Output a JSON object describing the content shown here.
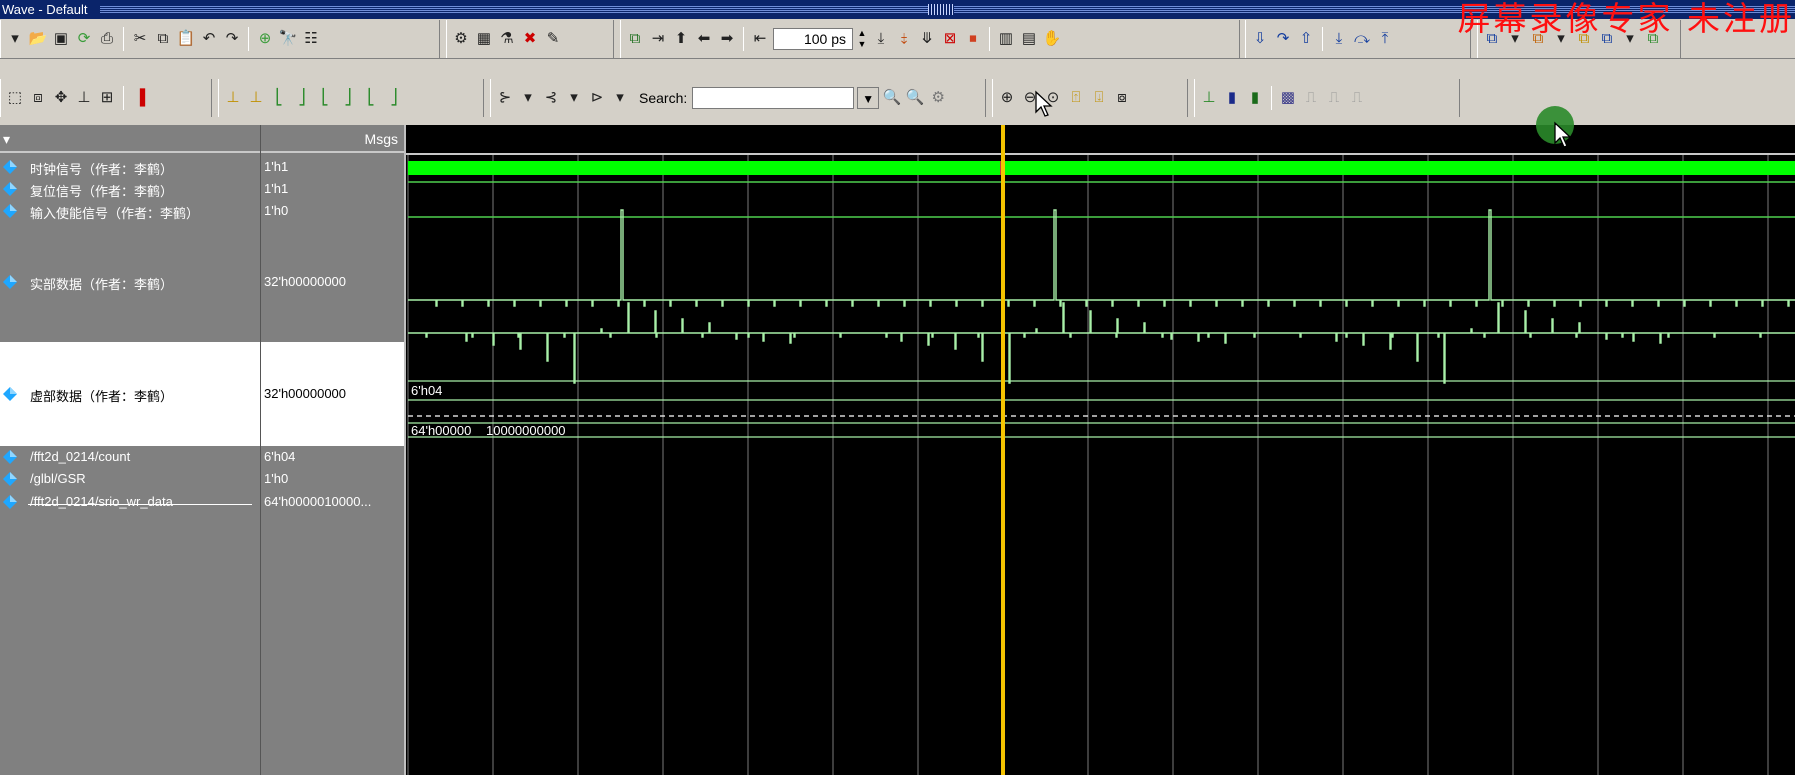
{
  "window": {
    "title": "Wave - Default",
    "watermark": "屏幕录像专家  未注册"
  },
  "toolbar": {
    "time_value": "100 ps",
    "search_label": "Search:",
    "search_value": ""
  },
  "panes": {
    "name_header": "",
    "value_header": "Msgs"
  },
  "signals": [
    {
      "name": "时钟信号（作者：李鹤）",
      "value": "1'h1"
    },
    {
      "name": "复位信号（作者：李鹤）",
      "value": "1'h1"
    },
    {
      "name": "输入使能信号（作者：李鹤）",
      "value": "1'h0"
    },
    {
      "name": "实部数据（作者：李鹤）",
      "value": "32'h00000000"
    },
    {
      "name": "虚部数据（作者：李鹤）",
      "value": "32'h00000000"
    },
    {
      "name": "/fft2d_0214/count",
      "value": "6'h04"
    },
    {
      "name": "/glbl/GSR",
      "value": "1'h0"
    },
    {
      "name": "/fft2d_0214/srio_wr_data",
      "value": "64'h0000010000..."
    }
  ],
  "wave_labels": {
    "count": "6'h04",
    "srio_wr_data_a": "64'h00000",
    "srio_wr_data_b": "10000000000"
  },
  "colors": {
    "wave_green": "#00ff00",
    "wave_trace": "#a8f0a8",
    "cursor": "#f5c400",
    "diamond": "#1fa7ff"
  }
}
